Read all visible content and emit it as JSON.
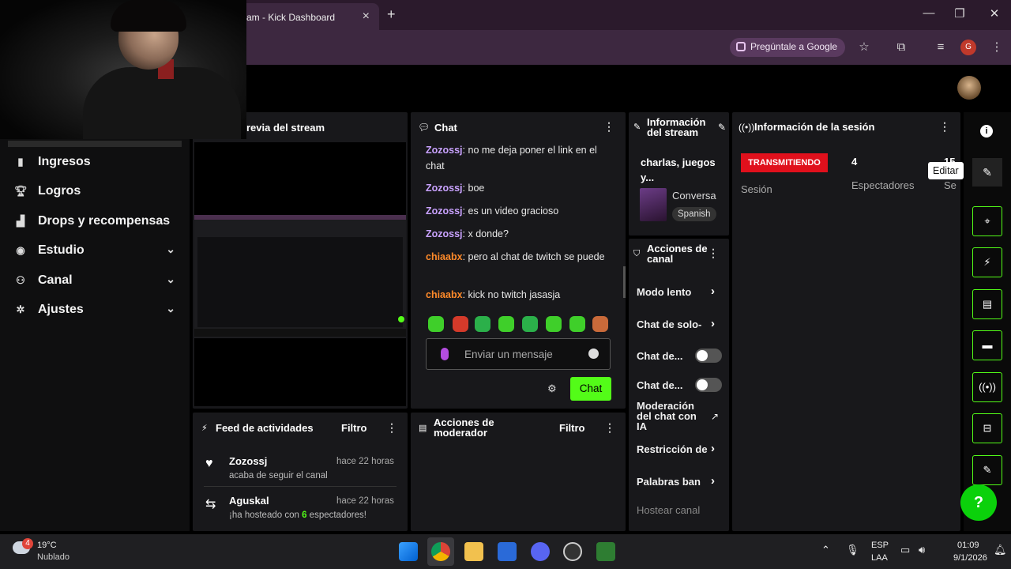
{
  "browser": {
    "tab_title": "am - Kick Dashboard",
    "ask_google": "Pregúntale a Google",
    "profile_initial": "G"
  },
  "sidebar": {
    "items": [
      {
        "label": "Ingresos",
        "icon": "bar-chart-icon"
      },
      {
        "label": "Logros",
        "icon": "trophy-icon"
      },
      {
        "label": "Drops y recompensas",
        "icon": "drops-icon"
      },
      {
        "label": "Estudio",
        "icon": "studio-icon"
      },
      {
        "label": "Canal",
        "icon": "people-icon"
      },
      {
        "label": "Ajustes",
        "icon": "gear-icon"
      }
    ]
  },
  "preview": {
    "title": "revia del stream"
  },
  "chat": {
    "title": "Chat",
    "messages": [
      {
        "user": "Zozossj",
        "text": "no me deja poner el link en el chat",
        "color": "#c9a2ff"
      },
      {
        "user": "Zozossj",
        "text": "boe",
        "color": "#c9a2ff"
      },
      {
        "user": "Zozossj",
        "text": "es un video gracioso",
        "color": "#c9a2ff"
      },
      {
        "user": "Zozossj",
        "text": "x donde?",
        "color": "#c9a2ff"
      },
      {
        "user": "chiaabx",
        "text": "pero al chat de twitch se puede",
        "color": "#ff8a2a"
      },
      {
        "user": "chiaabx",
        "text": "kick no twitch jasasja",
        "color": "#ff8a2a"
      }
    ],
    "input_placeholder": "Enviar un mensaje",
    "send_label": "Chat"
  },
  "stream_info": {
    "title": "Información del stream",
    "stream_title": "charlas, juegos y...",
    "category": "Conversa",
    "language": "Spanish"
  },
  "channel_actions": {
    "title": "Acciones de canal",
    "items": [
      {
        "label": "Modo lento",
        "kind": "chevron"
      },
      {
        "label": "Chat de solo-",
        "kind": "chevron"
      },
      {
        "label": "Chat de...",
        "kind": "toggle",
        "on": false
      },
      {
        "label": "Chat de...",
        "kind": "toggle",
        "on": false
      },
      {
        "label": "Moderación del chat con IA",
        "kind": "external"
      },
      {
        "label": "Restricción de",
        "kind": "chevron"
      },
      {
        "label": "Palabras ban",
        "kind": "chevron"
      },
      {
        "label": "Hostear canal",
        "kind": "muted"
      }
    ]
  },
  "session": {
    "title": "Información de la sesión",
    "live_badge": "TRANSMITIENDO",
    "session_label": "Sesión",
    "viewers_value": "4",
    "viewers_label": "Espectadores",
    "third_value": "15",
    "third_label": "Se"
  },
  "tooltip": {
    "edit": "Editar"
  },
  "feed": {
    "title": "Feed de actividades",
    "filter": "Filtro",
    "items": [
      {
        "name": "Zozossj",
        "time": "hace 22 horas",
        "desc": "acaba de seguir el canal",
        "icon": "heart-icon"
      },
      {
        "name": "Aguskal",
        "time": "hace 22 horas",
        "desc_pre": "¡ha hosteado con ",
        "desc_num": "6",
        "desc_post": " espectadores!",
        "icon": "host-icon"
      }
    ]
  },
  "mod_actions": {
    "title": "Acciones de moderador",
    "filter": "Filtro"
  },
  "taskbar": {
    "weather_temp": "19°C",
    "weather_desc": "Nublado",
    "weather_badge": "4",
    "lang": "ESP",
    "lang2": "LAA",
    "time": "01:09",
    "date": "9/1/2026"
  },
  "colors": {
    "accent": "#53fc18",
    "live": "#e0101c",
    "panel": "#18181b"
  }
}
